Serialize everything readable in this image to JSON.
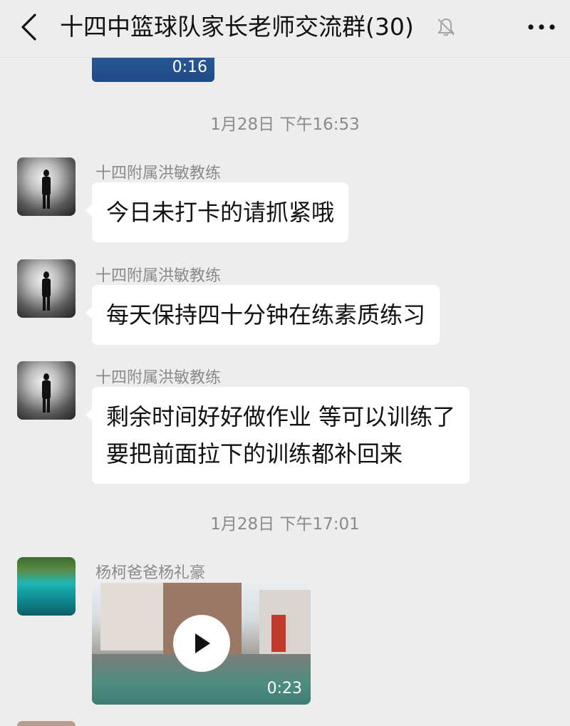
{
  "header": {
    "back_icon": "chevron-left-icon",
    "title": "十四中篮球队家长老师交流群(30)",
    "mute_icon": "bell-muted-icon",
    "more_icon": "more-dots-icon"
  },
  "top_video": {
    "duration": "0:16"
  },
  "messages": [
    {
      "type": "timestamp",
      "text": "1月28日 下午16:53"
    },
    {
      "type": "text",
      "sender": "十四附属洪敏教练",
      "text": "今日未打卡的请抓紧哦"
    },
    {
      "type": "text",
      "sender": "十四附属洪敏教练",
      "text": "每天保持四十分钟在练素质练习"
    },
    {
      "type": "text",
      "sender": "十四附属洪敏教练",
      "lines": [
        "剩余时间好好做作业 等可以训练了",
        "要把前面拉下的训练都补回来"
      ]
    },
    {
      "type": "timestamp",
      "text": "1月28日 下午17:01"
    },
    {
      "type": "video",
      "sender": "杨柯爸爸杨礼豪",
      "duration": "0:23",
      "icon": "play-icon"
    }
  ]
}
